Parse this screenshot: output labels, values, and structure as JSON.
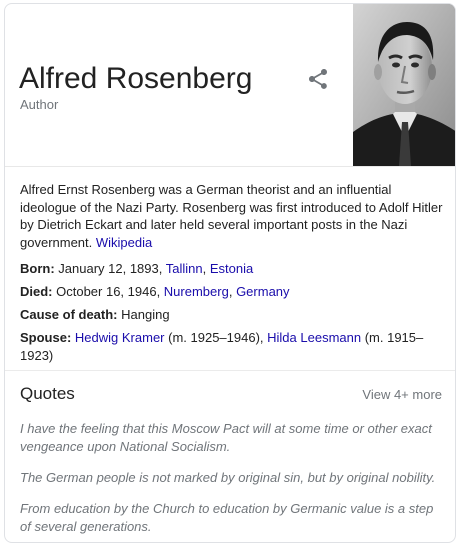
{
  "header": {
    "title": "Alfred Rosenberg",
    "subtitle": "Author",
    "share_icon": "share-icon"
  },
  "description": {
    "text": "Alfred Ernst Rosenberg was a German theorist and an influential ideologue of the Nazi Party. Rosenberg was first introduced to Adolf Hitler by Dietrich Eckart and later held several important posts in the Nazi government. ",
    "source_link": "Wikipedia"
  },
  "facts": {
    "born": {
      "label": "Born:",
      "text": " January 12, 1893, ",
      "link1": "Tallinn",
      "sep": ", ",
      "link2": "Estonia"
    },
    "died": {
      "label": "Died:",
      "text": " October 16, 1946, ",
      "link1": "Nuremberg",
      "sep": ", ",
      "link2": "Germany"
    },
    "cause": {
      "label": "Cause of death:",
      "text": " Hanging"
    },
    "spouse": {
      "label": "Spouse:",
      "link1": "Hedwig Kramer",
      "text1": " (m. 1925–1946), ",
      "link2": "Hilda Leesmann",
      "text2": " (m. 1915–1923)"
    }
  },
  "quotes": {
    "title": "Quotes",
    "view_more": "View 4+ more",
    "items": [
      "I have the feeling that this Moscow Pact will at some time or other exact vengeance upon National Socialism.",
      "The German people is not marked by original sin, but by original nobility.",
      "From education by the Church to education by Germanic value is a step of several generations."
    ]
  },
  "colors": {
    "link": "#1a0dab",
    "muted": "#70757a",
    "text": "#222222",
    "border": "#dfe1e5"
  }
}
